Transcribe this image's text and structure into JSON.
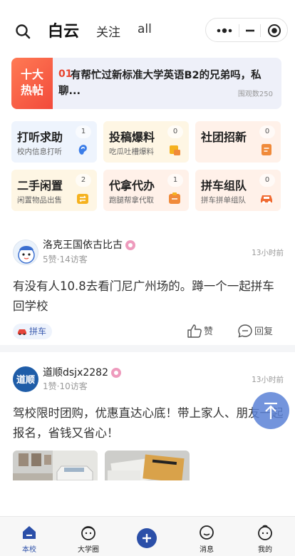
{
  "header": {
    "tabs": [
      "白云",
      "关注",
      "all"
    ]
  },
  "hot_banner": {
    "badge_line1": "十大",
    "badge_line2": "热帖",
    "rank": "01",
    "title": "有帮忙过新标准大学英语B2的兄弟吗，私聊...",
    "views": "围观数250"
  },
  "categories": [
    {
      "title": "打听求助",
      "sub": "校内信息打听",
      "count": "1",
      "icon": "ear-icon",
      "color": "#3b7de8"
    },
    {
      "title": "投稿爆料",
      "sub": "吃瓜吐槽爆料",
      "count": "0",
      "icon": "megaphone-icon",
      "color": "#f5b21f"
    },
    {
      "title": "社团招新",
      "sub": "",
      "count": "0",
      "icon": "document-icon",
      "color": "#f08a3a"
    },
    {
      "title": "二手闲置",
      "sub": "闲置物品出售",
      "count": "2",
      "icon": "exchange-icon",
      "color": "#f5b21f"
    },
    {
      "title": "代拿代办",
      "sub": "跑腿帮拿代取",
      "count": "1",
      "icon": "box-icon",
      "color": "#f08a3a"
    },
    {
      "title": "拼车组队",
      "sub": "拼车拼单组队",
      "count": "0",
      "icon": "car-icon",
      "color": "#f06b32"
    }
  ],
  "posts": [
    {
      "author": "洛克王国依古比古",
      "meta": "5赞·14访客",
      "time": "13小时前",
      "body": "有没有人10.8去看门尼广州场的。蹲一个一起拼车回学校",
      "tag": "拼车",
      "like_label": "赞",
      "reply_label": "回复"
    },
    {
      "author": "道顺dsjx2282",
      "avatar_text": "道顺",
      "meta": "1赞·10访客",
      "time": "13小时前",
      "body": "驾校限时团购，优惠直达心底！带上家人、朋友一起报名，省钱又省心！"
    }
  ],
  "bottom_nav": [
    {
      "label": "本校",
      "active": true
    },
    {
      "label": "大学圈"
    },
    {
      "label": ""
    },
    {
      "label": "消息"
    },
    {
      "label": "我的"
    }
  ],
  "colors": {
    "brand": "#2b4fa8",
    "hot_red": "#e7442f",
    "fab": "#5b81d6"
  }
}
